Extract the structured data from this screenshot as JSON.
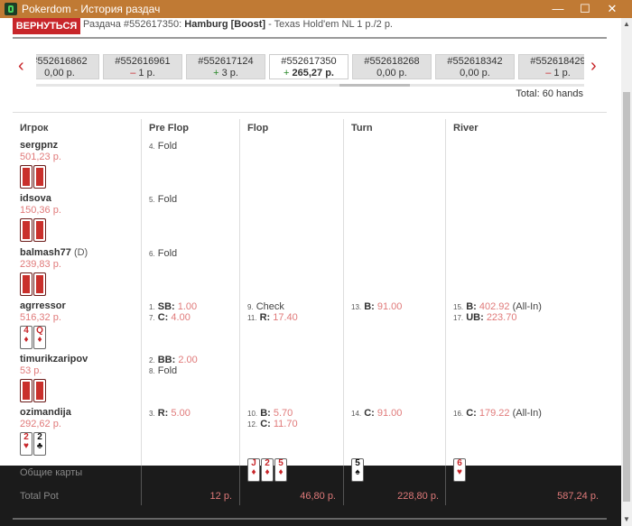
{
  "window": {
    "title": "Pokerdom - История раздач",
    "minimize": "—",
    "maximize": "☐",
    "close": "✕"
  },
  "header": {
    "back_label": "ВЕРНУТЬСЯ",
    "hand_prefix": "Раздача #552617350:",
    "table_name": "Hamburg [Boost]",
    "game_info": "- Texas Hold'em NL  1 р./2 р."
  },
  "hands_nav": {
    "prev": "‹",
    "next": "›",
    "total": "Total: 60 hands",
    "items": [
      {
        "id": "#552616862",
        "sign": "",
        "amount": "0,00 р.",
        "type": "neutral"
      },
      {
        "id": "#552616961",
        "sign": "–",
        "amount": "1 р.",
        "type": "neg"
      },
      {
        "id": "#552617124",
        "sign": "+",
        "amount": "3 р.",
        "type": "pos"
      },
      {
        "id": "#552617350",
        "sign": "+",
        "amount": "265,27 р.",
        "type": "pos",
        "active": true
      },
      {
        "id": "#552618268",
        "sign": "",
        "amount": "0,00 р.",
        "type": "neutral"
      },
      {
        "id": "#552618342",
        "sign": "",
        "amount": "0,00 р.",
        "type": "neutral"
      },
      {
        "id": "#552618429",
        "sign": "–",
        "amount": "1 р.",
        "type": "neg"
      }
    ]
  },
  "columns": {
    "player": "Игрок",
    "preflop": "Pre Flop",
    "flop": "Flop",
    "turn": "Turn",
    "river": "River"
  },
  "players": [
    {
      "name": "sergpnz",
      "dealer": "",
      "stack": "501,23 р."
    },
    {
      "name": "idsova",
      "dealer": "",
      "stack": "150,36 р."
    },
    {
      "name": "balmash77",
      "dealer": "(D)",
      "stack": "239,83 р."
    },
    {
      "name": "agrressor",
      "dealer": "",
      "stack": "516,32 р.",
      "cards": [
        {
          "rank": "4",
          "suit": "♦"
        },
        {
          "rank": "Q",
          "suit": "♦"
        }
      ]
    },
    {
      "name": "timurikzaripov",
      "dealer": "",
      "stack": "53 р."
    },
    {
      "name": "ozimandija",
      "dealer": "",
      "stack": "292,62 р.",
      "cards": [
        {
          "rank": "2",
          "suit": "♥"
        },
        {
          "rank": "2",
          "suit": "♣"
        }
      ]
    }
  ],
  "actions": {
    "sergpnz_pre": {
      "num": "4.",
      "act": "Fold"
    },
    "idsova_pre": {
      "num": "5.",
      "act": "Fold"
    },
    "balmash_pre": {
      "num": "6.",
      "act": "Fold"
    },
    "agr_pre1": {
      "num": "1.",
      "act": "SB:",
      "amt": "1.00"
    },
    "agr_pre2": {
      "num": "7.",
      "act": "C:",
      "amt": "4.00"
    },
    "agr_flop1": {
      "num": "9.",
      "act": "Check"
    },
    "agr_flop2": {
      "num": "11.",
      "act": "R:",
      "amt": "17.40"
    },
    "agr_turn": {
      "num": "13.",
      "act": "B:",
      "amt": "91.00"
    },
    "agr_river1": {
      "num": "15.",
      "act": "B:",
      "amt": "402.92",
      "note": "(All-In)"
    },
    "agr_river2": {
      "num": "17.",
      "act": "UB:",
      "amt": "223.70"
    },
    "tim_pre1": {
      "num": "2.",
      "act": "BB:",
      "amt": "2.00"
    },
    "tim_pre2": {
      "num": "8.",
      "act": "Fold"
    },
    "ozi_pre": {
      "num": "3.",
      "act": "R:",
      "amt": "5.00"
    },
    "ozi_flop1": {
      "num": "10.",
      "act": "B:",
      "amt": "5.70"
    },
    "ozi_flop2": {
      "num": "12.",
      "act": "C:",
      "amt": "11.70"
    },
    "ozi_turn": {
      "num": "14.",
      "act": "C:",
      "amt": "91.00"
    },
    "ozi_river": {
      "num": "16.",
      "act": "C:",
      "amt": "179.22",
      "note": "(All-In)"
    }
  },
  "board": {
    "label": "Общие карты",
    "flop": [
      {
        "rank": "J",
        "suit": "♦"
      },
      {
        "rank": "2",
        "suit": "♦"
      },
      {
        "rank": "5",
        "suit": "♦"
      }
    ],
    "turn": {
      "rank": "5",
      "suit": "♠"
    },
    "river": {
      "rank": "6",
      "suit": "♥"
    }
  },
  "pot": {
    "label": "Total Pot",
    "preflop": "12 р.",
    "flop": "46,80 р.",
    "turn": "228,80 р.",
    "river": "587,24 р."
  },
  "colors": {
    "titlebar": "#c07a34",
    "accent_red": "#c8262a",
    "amount_pink": "#e07a7a",
    "footer_bg": "#1b1b1b"
  }
}
